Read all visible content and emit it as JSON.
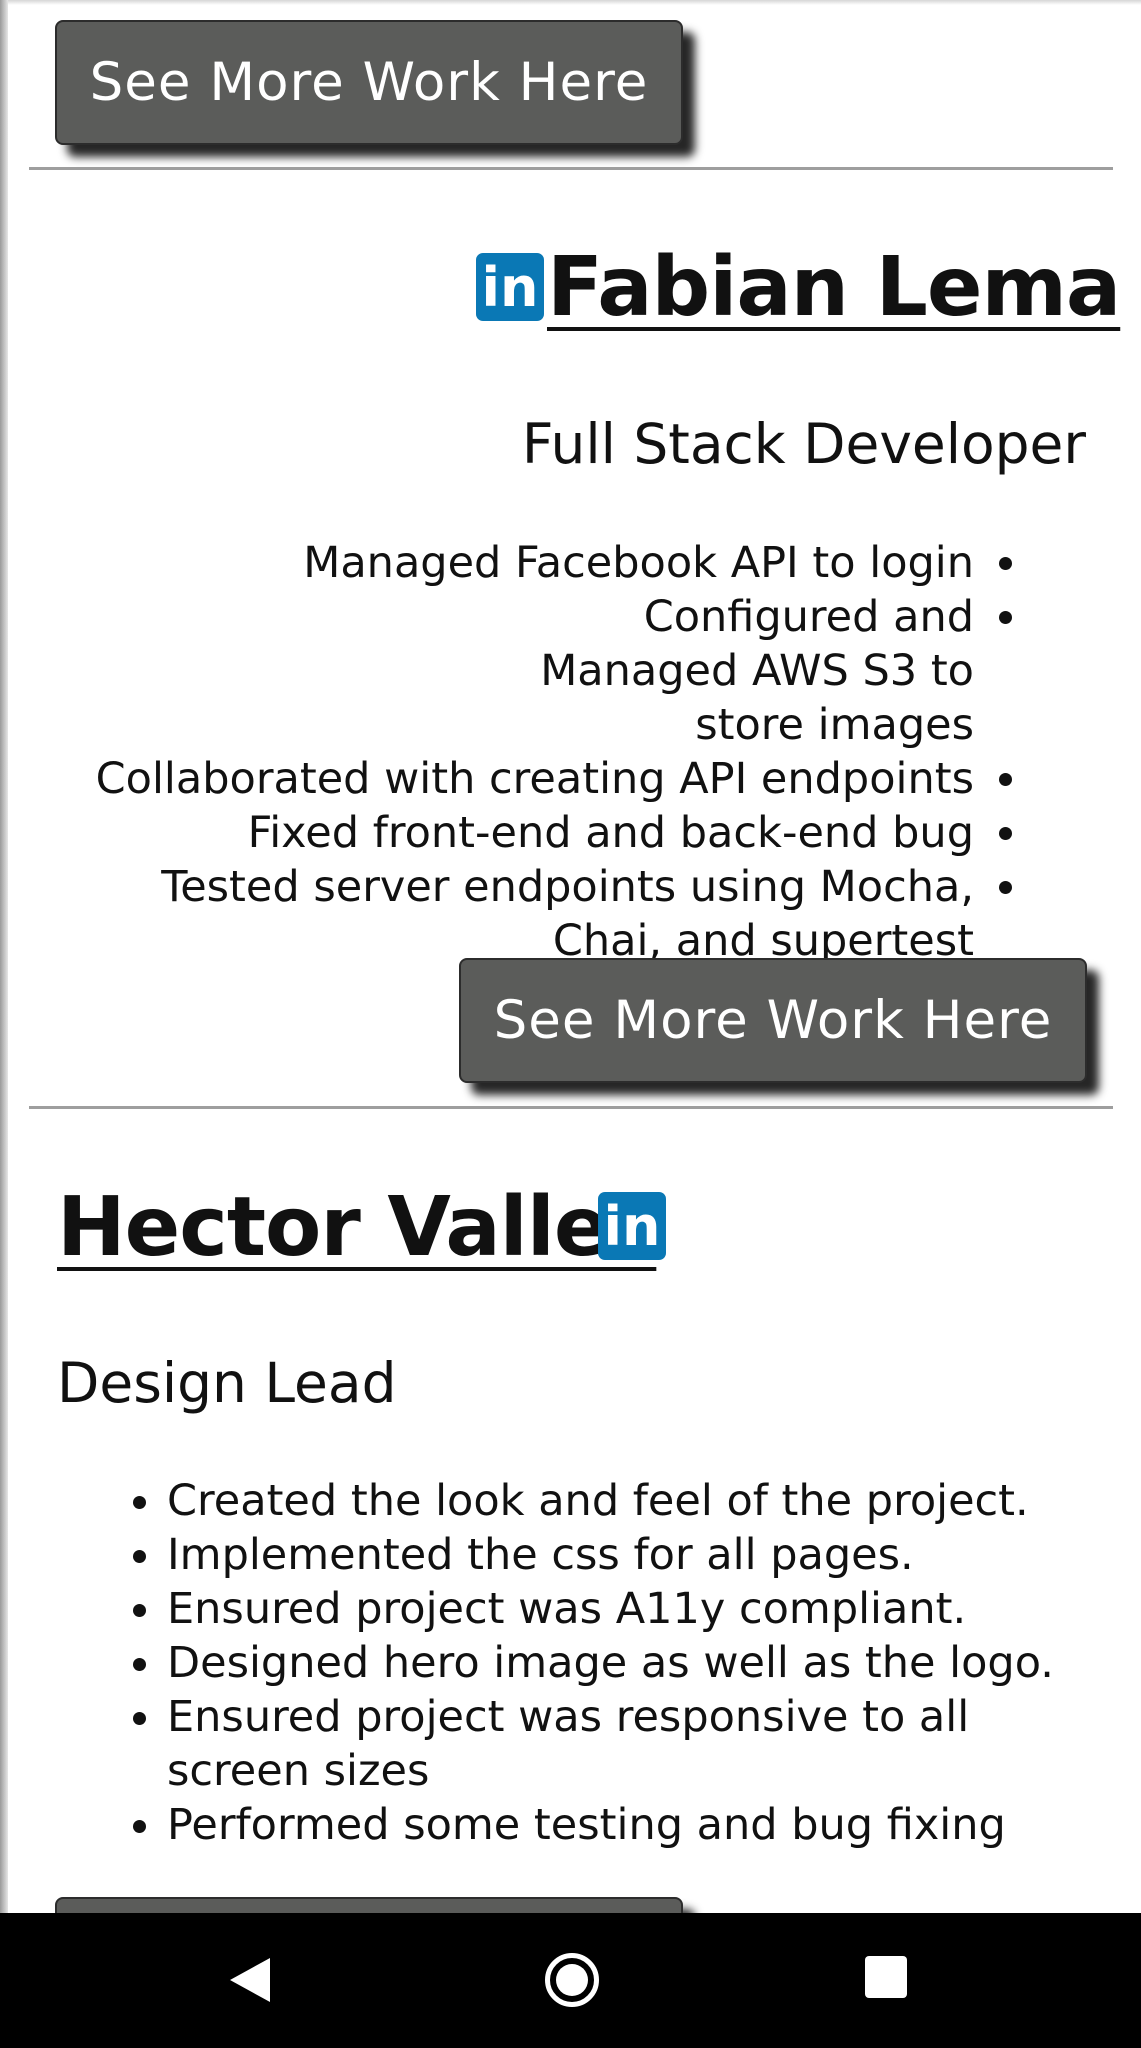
{
  "buttons": {
    "see_more_label": "See More Work Here"
  },
  "profiles": [
    {
      "name": "Fabian Lema",
      "linkedin_icon_text": "in",
      "role": "Full Stack Developer",
      "duties": [
        "Managed Facebook API to login",
        "Configured and Managed AWS S3 to store images",
        "Collaborated with creating API endpoints",
        "Fixed front-end and back-end bug",
        "Tested server endpoints using Mocha, Chai, and supertest"
      ]
    },
    {
      "name": "Hector Valles",
      "linkedin_icon_text": "in",
      "role": "Design Lead",
      "duties": [
        "Created the look and feel of the project.",
        "Implemented the css for all pages.",
        "Ensured project was A11y compliant.",
        "Designed hero image as well as the logo.",
        "Ensured project was responsive to all screen sizes",
        "Performed some testing and bug fixing"
      ]
    }
  ],
  "colors": {
    "button_bg": "#5b5c5a",
    "linkedin_blue": "#0a78b5",
    "navbar_bg": "#000000"
  },
  "nav": {
    "back_icon": "back-triangle-icon",
    "home_icon": "home-circle-icon",
    "recents_icon": "recents-square-icon"
  }
}
